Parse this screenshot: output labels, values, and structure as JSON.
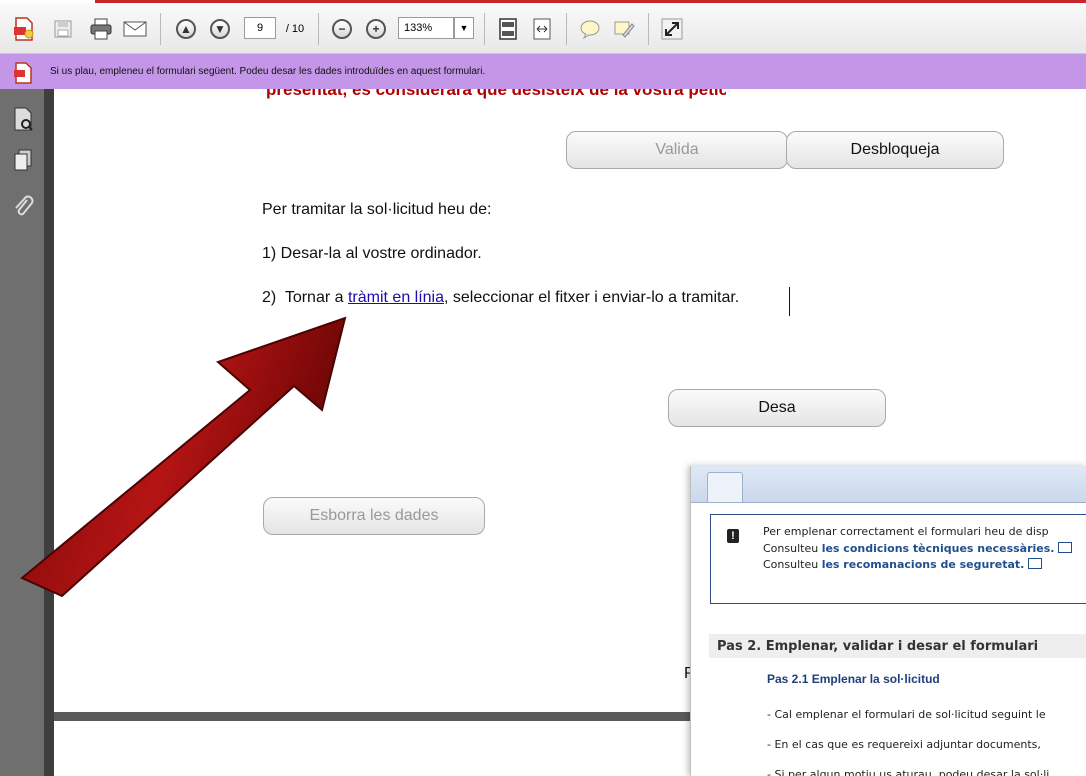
{
  "toolbar": {
    "page_current": "9",
    "page_total": "/ 10",
    "zoom": "133%"
  },
  "form_bar": {
    "message": "Si us plau, empleneu el formulari següent. Podeu desar les dades introduïdes en aquest formulari."
  },
  "page": {
    "cut_text": "presentat, es considerarà que desisteix de la vostra petició.",
    "valida_label": "Valida",
    "desbloqueja_label": "Desbloqueja",
    "instructions_intro": "Per tramitar la sol·licitud heu de:",
    "step1": "1)  Desar-la al vostre ordinador.",
    "step2_prefix": "2)  Tornar a ",
    "step2_link": "tràmit en línia",
    "step2_suffix": ", seleccionar el fitxer i enviar-lo a tramitar.",
    "desa_label": "Desa",
    "esborra_label": "Esborra les dades",
    "partial_letter": "P"
  },
  "overlay": {
    "notice_line1": "Per emplenar correctament el formulari heu de disp",
    "notice_line2_prefix": "Consulteu ",
    "notice_line2_link": "les condicions tècniques necessàries.",
    "notice_line3_prefix": "Consulteu ",
    "notice_line3_link": "les recomanacions de seguretat.",
    "pas2_heading": "Pas 2. Emplenar, validar i desar el formulari",
    "pas21_heading": "Pas 2.1 Emplenar la sol·licitud",
    "bullet1": "- Cal emplenar el formulari de sol·licitud seguint le",
    "bullet2": "- En el cas que es requereixi adjuntar documents,",
    "bullet3": "- Si per algun motiu us aturau, podeu desar la sol·li"
  },
  "colors": {
    "form_bar": "#c496e8",
    "arrow": "#a01010",
    "link": "#1a0dab"
  }
}
